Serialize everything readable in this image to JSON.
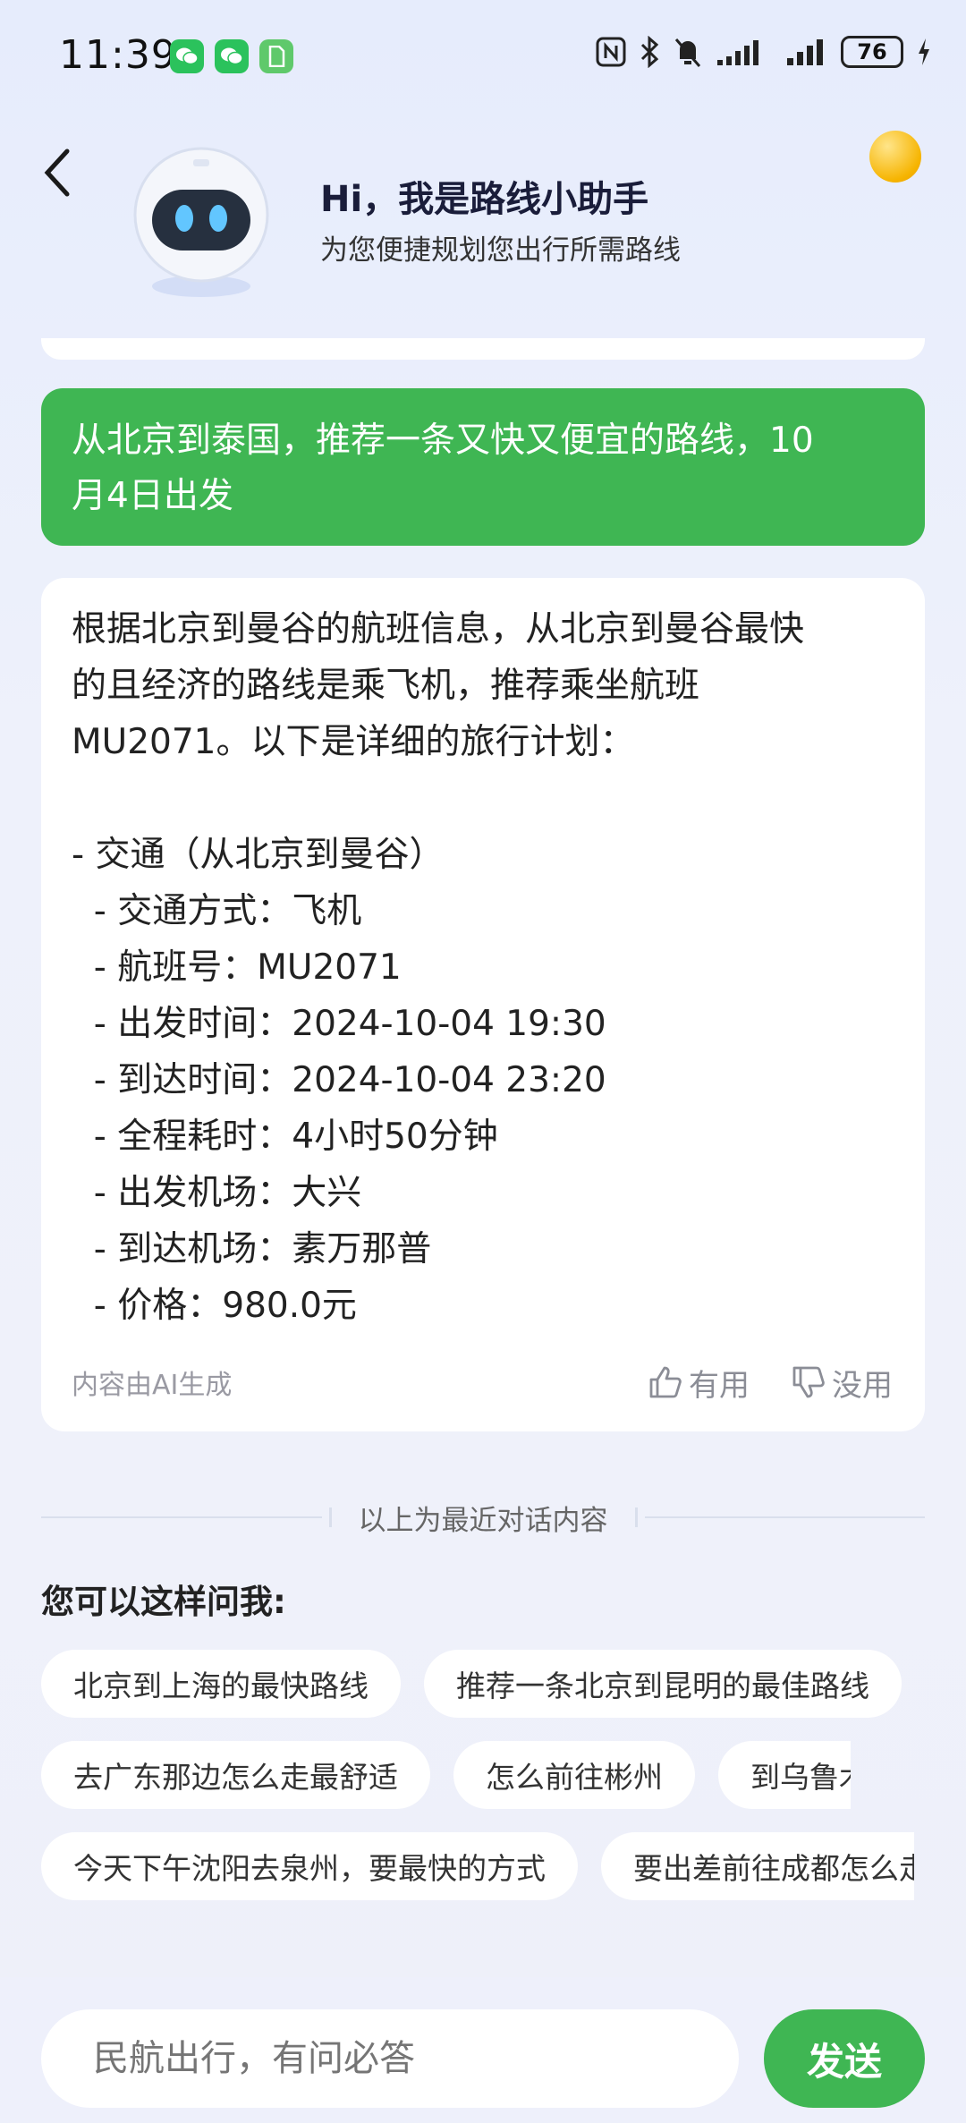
{
  "status_bar": {
    "time": "11:39",
    "battery": "76"
  },
  "header": {
    "title": "Hi，我是路线小助手",
    "subtitle": "为您便捷规划您出行所需路线"
  },
  "user_message": "从北京到泰国，推荐一条又快又便宜的路线，10月4日出发",
  "user_message_lines": [
    "从北京到泰国，推荐一条又快又便宜的路线，10",
    "月4日出发"
  ],
  "answer": {
    "lines": [
      "根据北京到曼谷的航班信息，从北京到曼谷最快",
      "的且经济的路线是乘飞机，推荐乘坐航班",
      "MU2071。以下是详细的旅行计划：",
      "",
      "- 交通（从北京到曼谷）",
      "  - 交通方式：飞机",
      "  - 航班号：MU2071",
      "  - 出发时间：2024-10-04 19:30",
      "  - 到达时间：2024-10-04 23:20",
      "  - 全程耗时：4小时50分钟",
      "  - 出发机场：大兴",
      "  - 到达机场：素万那普",
      "  - 价格：980.0元"
    ],
    "ai_note": "内容由AI生成",
    "useful_label": "有用",
    "useless_label": "没用"
  },
  "divider_text": "以上为最近对话内容",
  "suggestions": {
    "title": "您可以这样问我:",
    "rows": [
      [
        "北京到上海的最快路线",
        "推荐一条北京到昆明的最佳路线"
      ],
      [
        "去广东那边怎么走最舒适",
        "怎么前往彬州",
        "到乌鲁木齐这"
      ],
      [
        "今天下午沈阳去泉州，要最快的方式",
        "要出差前往成都怎么走"
      ]
    ]
  },
  "input": {
    "placeholder": "民航出行，有问必答",
    "send_label": "发送"
  },
  "colors": {
    "accent_green": "#3fb653",
    "coin_gold": "#f6b400"
  }
}
